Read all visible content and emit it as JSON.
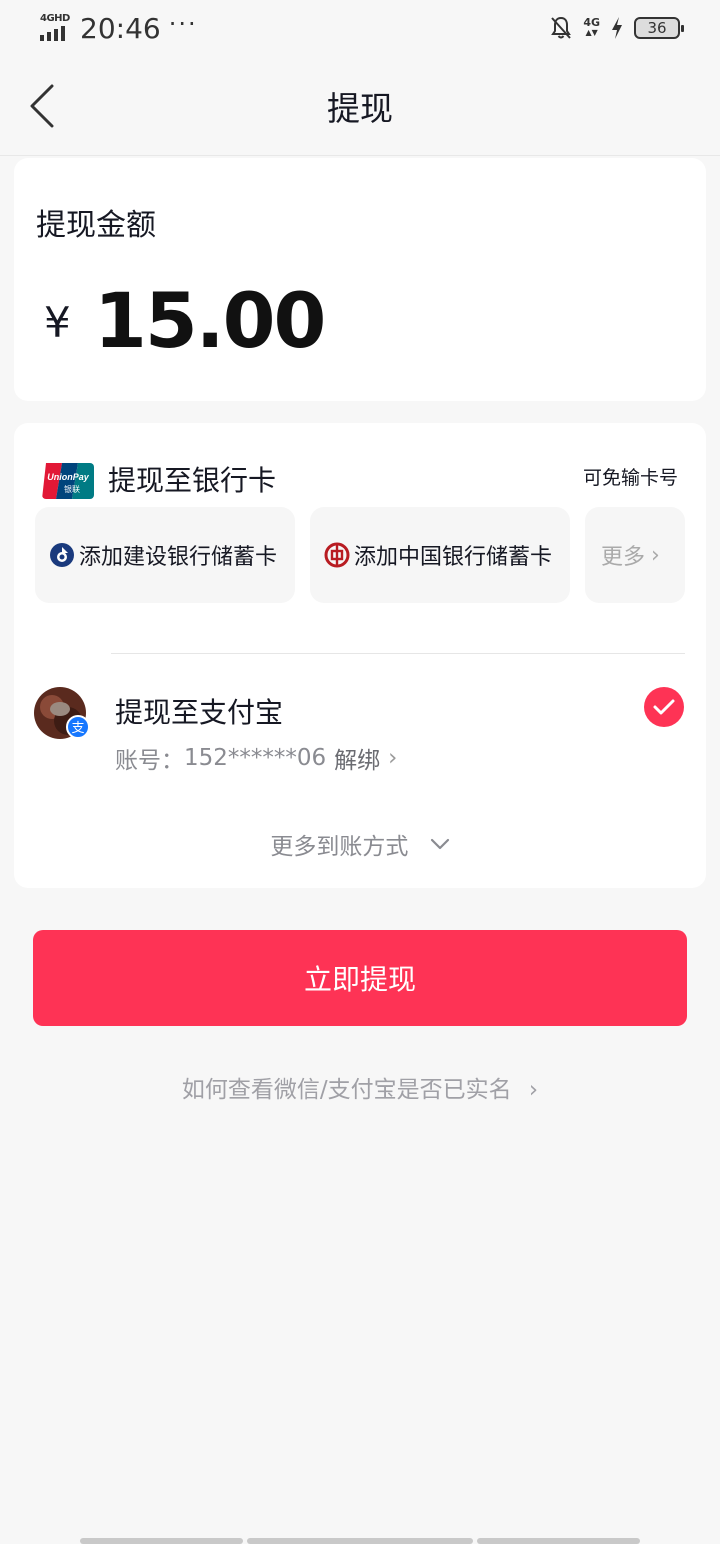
{
  "status_bar": {
    "network_label": "4GHD",
    "time": "20:46",
    "more_dots": "···",
    "net_4g": "4G",
    "battery": "36"
  },
  "header": {
    "title": "提现"
  },
  "amount": {
    "label": "提现金额",
    "currency": "¥",
    "value": "15.00"
  },
  "bank": {
    "title": "提现至银行卡",
    "no_input_label": "可免输卡号",
    "chips": [
      {
        "label": "添加建设银行储蓄卡"
      },
      {
        "label": "添加中国银行储蓄卡"
      }
    ],
    "more_label": "更多",
    "more_arrow": "›"
  },
  "alipay": {
    "title": "提现至支付宝",
    "account_prefix": "账号：",
    "account_number": "152******06",
    "unbind_label": "解绑",
    "unbind_arrow": "›",
    "badge_char": "支",
    "selected": true
  },
  "more_methods": {
    "label": "更多到账方式"
  },
  "withdraw_button": {
    "label": "立即提现"
  },
  "help_link": {
    "label": "如何查看微信/支付宝是否已实名",
    "arrow": "›"
  },
  "colors": {
    "accent": "#fe3355",
    "alipay_blue": "#1677ff",
    "ccb_blue": "#1a3a7d",
    "boc_red": "#b81c22"
  }
}
